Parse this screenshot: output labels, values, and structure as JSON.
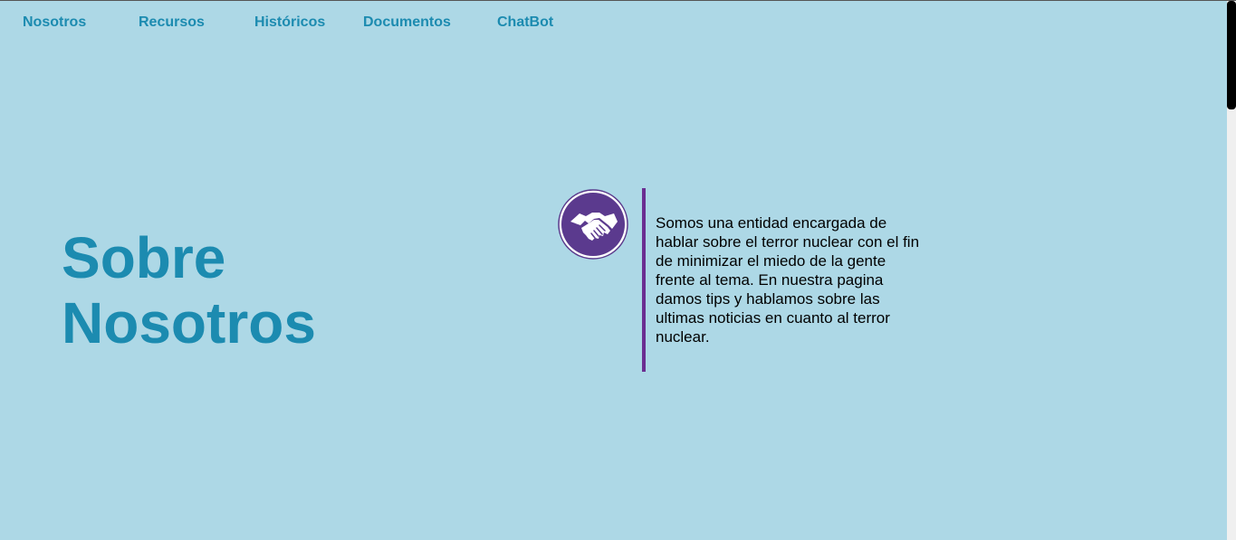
{
  "nav": {
    "items": [
      {
        "label": "Nosotros"
      },
      {
        "label": "Recursos"
      },
      {
        "label": "Históricos"
      },
      {
        "label": "Documentos"
      },
      {
        "label": "ChatBot"
      }
    ]
  },
  "hero": {
    "title_line1": "Sobre",
    "title_line2": "Nosotros"
  },
  "about": {
    "icon": "handshake-icon",
    "text": "Somos una entidad encargada de hablar sobre el terror nuclear con el fin de minimizar el miedo de la gente frente al tema. En nuestra pagina damos tips y hablamos sobre las ultimas noticias en cuanto al terror nuclear."
  },
  "colors": {
    "background": "#add8e6",
    "accent": "#1c8bb0",
    "purple": "#6b2e91"
  }
}
